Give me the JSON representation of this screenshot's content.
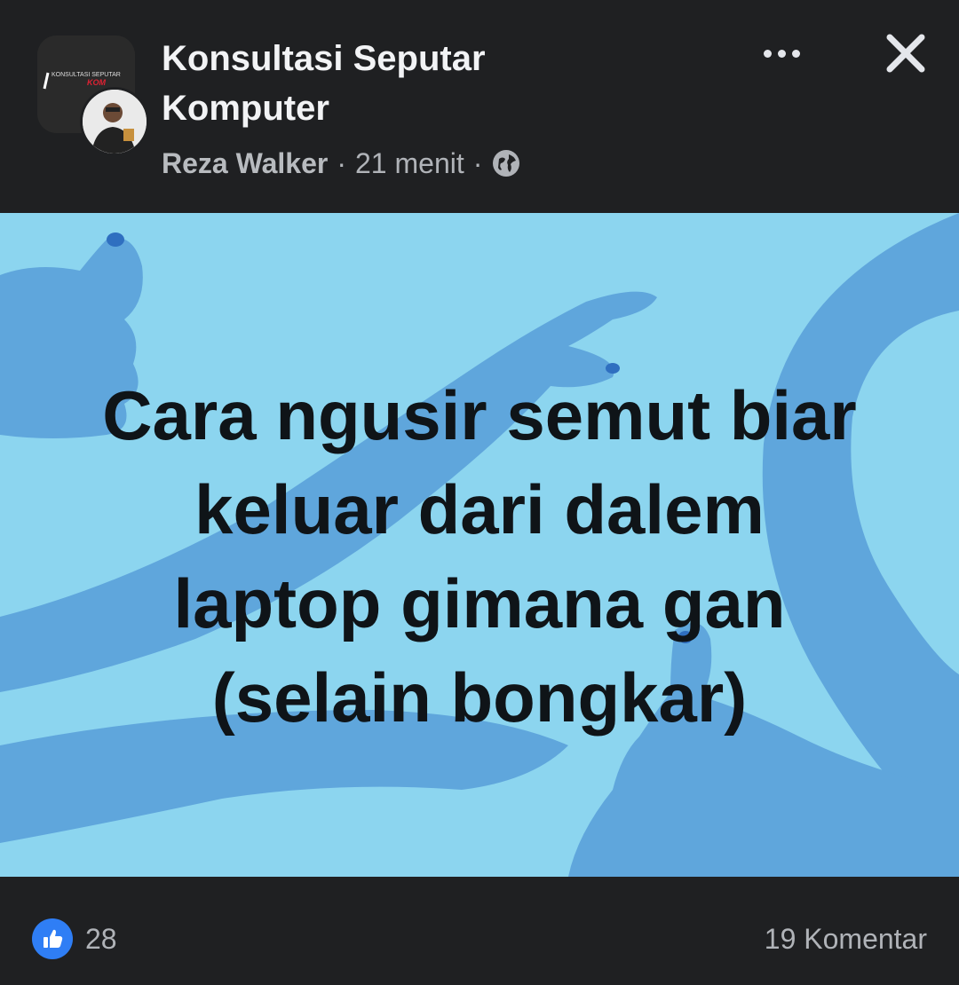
{
  "post": {
    "group_name": "Konsultasi Seputar\nKomputer",
    "author": "Reza Walker",
    "time": "21 menit",
    "separator": "·",
    "privacy_icon": "globe-icon",
    "group_avatar_text": "KONSULTASI SEPUTAR",
    "body_text": "Cara ngusir semut biar\nkeluar dari dalem\nlaptop  gimana gan\n(selain bongkar)",
    "background_color": "#8cd5ef",
    "pattern_color": "#5fa6dc"
  },
  "reactions": {
    "icon": "thumbs-up-icon",
    "count": "28"
  },
  "comments": {
    "label": "19 Komentar"
  },
  "actions": {
    "more_icon": "more-options-icon",
    "close_icon": "close-icon"
  }
}
